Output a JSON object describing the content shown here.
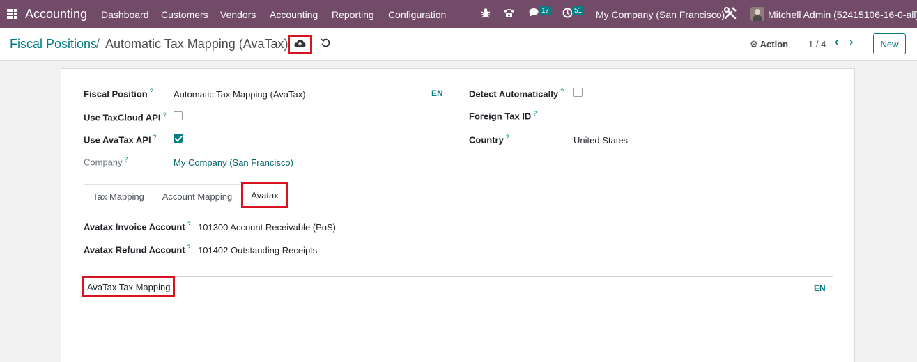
{
  "navbar": {
    "brand": "Accounting",
    "menus": [
      "Dashboard",
      "Customers",
      "Vendors",
      "Accounting",
      "Reporting",
      "Configuration"
    ],
    "messages_count": "17",
    "activities_count": "51",
    "company": "My Company (San Francisco)",
    "user": "Mitchell Admin (52415106-16-0-all)"
  },
  "control_panel": {
    "breadcrumb_parent": "Fiscal Positions",
    "breadcrumb_separator": "/",
    "breadcrumb_current": "Automatic Tax Mapping (AvaTax)",
    "action_label": "Action",
    "pager": "1 / 4",
    "new_label": "New"
  },
  "form": {
    "fiscal_position_label": "Fiscal Position",
    "fiscal_position_value": "Automatic Tax Mapping (AvaTax)",
    "lang": "EN",
    "use_taxcloud_label": "Use TaxCloud API",
    "use_taxcloud_checked": false,
    "use_avatax_label": "Use AvaTax API",
    "use_avatax_checked": true,
    "company_label": "Company",
    "company_value": "My Company (San Francisco)",
    "detect_auto_label": "Detect Automatically",
    "detect_auto_checked": false,
    "foreign_tax_label": "Foreign Tax ID",
    "country_label": "Country",
    "country_value": "United States",
    "help_marker": "?"
  },
  "tabs": [
    {
      "label": "Tax Mapping",
      "active": false
    },
    {
      "label": "Account Mapping",
      "active": false
    },
    {
      "label": "Avatax",
      "active": true
    }
  ],
  "avatax_tab": {
    "invoice_account_label": "Avatax Invoice Account",
    "invoice_account_value": "101300 Account Receivable (PoS)",
    "refund_account_label": "Avatax Refund Account",
    "refund_account_value": "101402 Outstanding Receipts",
    "mapping_label": "AvaTax Tax Mapping",
    "mapping_lang": "EN"
  },
  "colors": {
    "navbar": "#714b67",
    "accent": "#017e84",
    "highlight": "#d6131f"
  }
}
